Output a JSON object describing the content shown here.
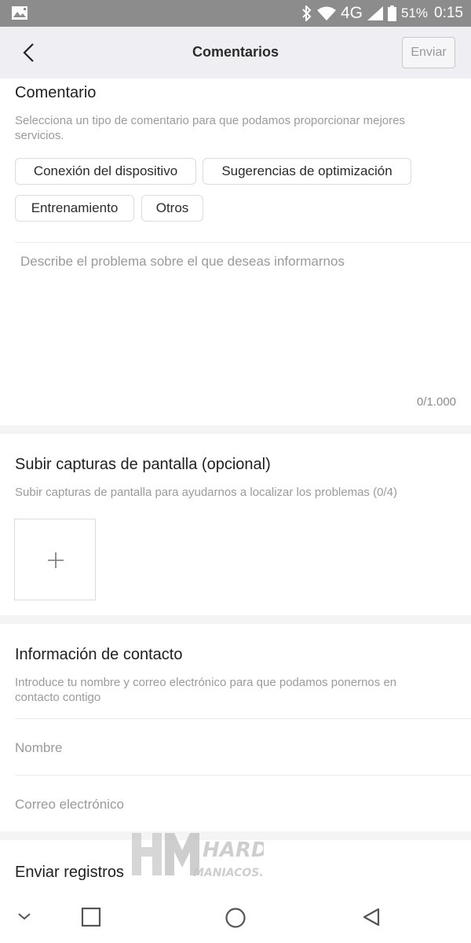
{
  "status_bar": {
    "network": "4G",
    "battery": "51%",
    "time": "0:15"
  },
  "header": {
    "title": "Comentarios",
    "send_label": "Enviar"
  },
  "feedback": {
    "title": "Comentario",
    "description": "Selecciona un tipo de comentario para que podamos proporcionar mejores servicios.",
    "chips": [
      "Conexión del dispositivo",
      "Sugerencias de optimización",
      "Entrenamiento",
      "Otros"
    ],
    "placeholder": "Describe el problema sobre el que deseas informarnos",
    "counter": "0/1.000"
  },
  "screenshots": {
    "title": "Subir capturas de pantalla (opcional)",
    "description": "Subir capturas de pantalla para ayudarnos a localizar los problemas (0/4)"
  },
  "contact": {
    "title": "Información de contacto",
    "description": "Introduce tu nombre y correo electrónico para que podamos ponernos en contacto contigo",
    "name_placeholder": "Nombre",
    "email_placeholder": "Correo electrónico"
  },
  "logs": {
    "title": "Enviar registros"
  },
  "watermark": {
    "line1": "HARD",
    "line2": "MANIACOS.COM"
  },
  "icons": {
    "gallery": "image-icon",
    "bluetooth": "bluetooth-icon",
    "wifi": "wifi-icon",
    "signal": "cell-signal-icon",
    "battery": "battery-icon",
    "back": "chevron-left-icon",
    "add": "plus-icon",
    "nav_down": "chevron-down-icon",
    "nav_recents": "square-icon",
    "nav_home": "circle-icon",
    "nav_back": "triangle-back-icon"
  }
}
